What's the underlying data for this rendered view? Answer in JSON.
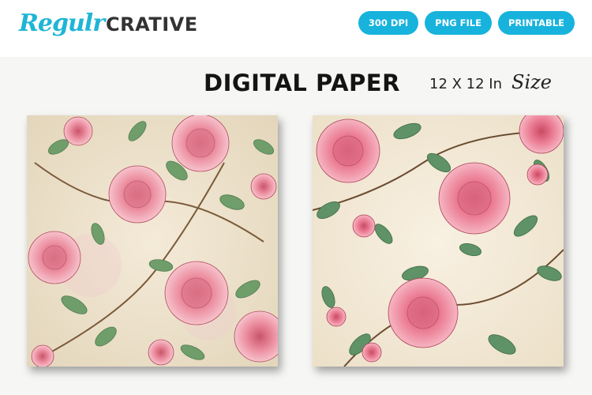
{
  "brand": {
    "script_part": "Regulr",
    "bold_part": "CRATIVE",
    "accent_color": "#1fb5d6"
  },
  "badges": [
    "300 DPI",
    "PNG FILE",
    "PRINTABLE"
  ],
  "title": "DIGITAL PAPER",
  "size": {
    "text": "12 X 12 In",
    "word": "Size"
  },
  "papers": [
    {
      "motif": "pink-rose-floral",
      "background": "#efe4cf"
    },
    {
      "motif": "pink-rose-floral",
      "background": "#f4ead9"
    }
  ]
}
